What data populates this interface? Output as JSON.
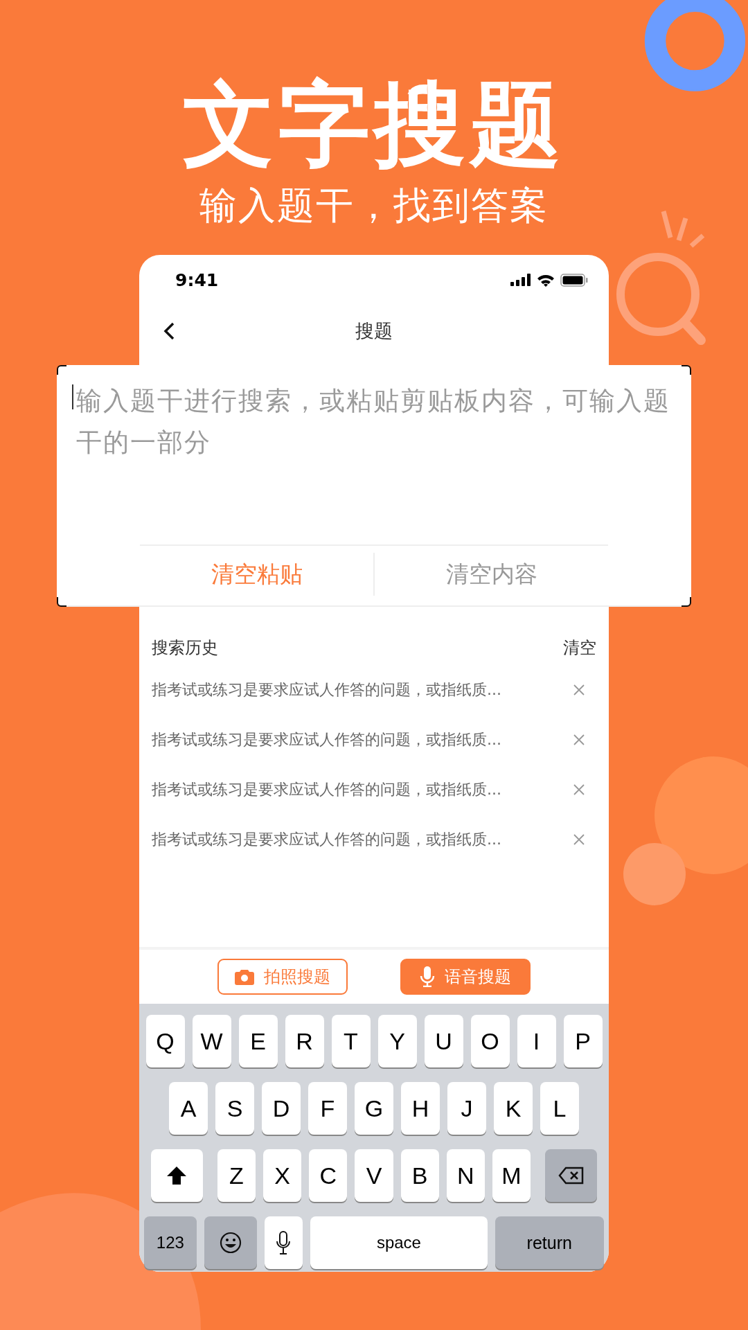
{
  "title": "文字搜题",
  "subtitle": "输入题干，找到答案",
  "phone": {
    "status_bar": {
      "time": "9:41"
    },
    "nav": {
      "title": "搜题"
    },
    "input": {
      "placeholder": "输入题干进行搜索，或粘贴剪贴板内容，可输入题干的一部分"
    },
    "actions": [
      {
        "label": "清空粘贴",
        "selected": true
      },
      {
        "label": "清空内容",
        "selected": false
      }
    ],
    "history": {
      "title": "搜索历史",
      "clear": "清空",
      "items": [
        {
          "text": "指考试或练习是要求应试人作答的问题，或指纸质..."
        },
        {
          "text": "指考试或练习是要求应试人作答的问题，或指纸质..."
        },
        {
          "text": "指考试或练习是要求应试人作答的问题，或指纸质..."
        },
        {
          "text": "指考试或练习是要求应试人作答的问题，或指纸质..."
        }
      ]
    },
    "toolbar": [
      {
        "label": "拍照搜题",
        "kind": "camera",
        "selected": false
      },
      {
        "label": "语音搜题",
        "kind": "mic",
        "selected": true
      }
    ],
    "keyboard": [
      [
        {
          "kind": "letter",
          "label": "Q"
        },
        {
          "kind": "letter",
          "label": "W"
        },
        {
          "kind": "letter",
          "label": "E"
        },
        {
          "kind": "letter",
          "label": "R"
        },
        {
          "kind": "letter",
          "label": "T"
        },
        {
          "kind": "letter",
          "label": "Y"
        },
        {
          "kind": "letter",
          "label": "U"
        },
        {
          "kind": "letter",
          "label": "O"
        },
        {
          "kind": "letter",
          "label": "I"
        },
        {
          "kind": "letter",
          "label": "P"
        }
      ],
      [
        {
          "kind": "letter",
          "label": "A"
        },
        {
          "kind": "letter",
          "label": "S"
        },
        {
          "kind": "letter",
          "label": "D"
        },
        {
          "kind": "letter",
          "label": "F"
        },
        {
          "kind": "letter",
          "label": "G"
        },
        {
          "kind": "letter",
          "label": "H"
        },
        {
          "kind": "letter",
          "label": "J"
        },
        {
          "kind": "letter",
          "label": "K"
        },
        {
          "kind": "letter",
          "label": "L"
        }
      ],
      [
        {
          "kind": "shift"
        },
        {
          "kind": "letter",
          "label": "Z"
        },
        {
          "kind": "letter",
          "label": "X"
        },
        {
          "kind": "letter",
          "label": "C"
        },
        {
          "kind": "letter",
          "label": "V"
        },
        {
          "kind": "letter",
          "label": "B"
        },
        {
          "kind": "letter",
          "label": "N"
        },
        {
          "kind": "letter",
          "label": "M"
        },
        {
          "kind": "delete"
        }
      ],
      [
        {
          "kind": "numbers",
          "label": "123"
        },
        {
          "kind": "emoji"
        },
        {
          "kind": "mic"
        },
        {
          "kind": "space",
          "label": "space"
        },
        {
          "kind": "return",
          "label": "return"
        }
      ]
    ]
  }
}
